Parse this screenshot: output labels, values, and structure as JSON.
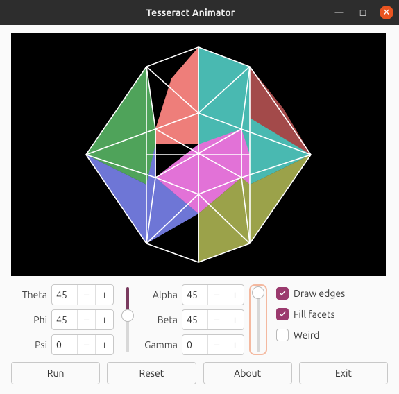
{
  "window": {
    "title": "Tesseract Animator"
  },
  "angles": {
    "theta": {
      "label": "Theta",
      "value": "45"
    },
    "phi": {
      "label": "Phi",
      "value": "45"
    },
    "psi": {
      "label": "Psi",
      "value": "0"
    },
    "alpha": {
      "label": "Alpha",
      "value": "45"
    },
    "beta": {
      "label": "Beta",
      "value": "45"
    },
    "gamma": {
      "label": "Gamma",
      "value": "0"
    }
  },
  "checks": {
    "draw_edges": {
      "label": "Draw edges",
      "checked": true
    },
    "fill_facets": {
      "label": "Fill facets",
      "checked": true
    },
    "weird": {
      "label": "Weird",
      "checked": false
    }
  },
  "buttons": {
    "run": "Run",
    "reset": "Reset",
    "about": "About",
    "exit": "Exit"
  },
  "glyphs": {
    "minus": "−",
    "plus": "+",
    "min_icon": "—",
    "max_icon": "◻",
    "close_icon": "✕"
  },
  "colors": {
    "green": "#4fa35a",
    "teal": "#49b9b1",
    "red": "#ee7e7a",
    "brown": "#a34a4a",
    "blue": "#6e76d6",
    "magenta": "#e272d7",
    "olive": "#9ba24a",
    "edge": "#ffffff"
  }
}
